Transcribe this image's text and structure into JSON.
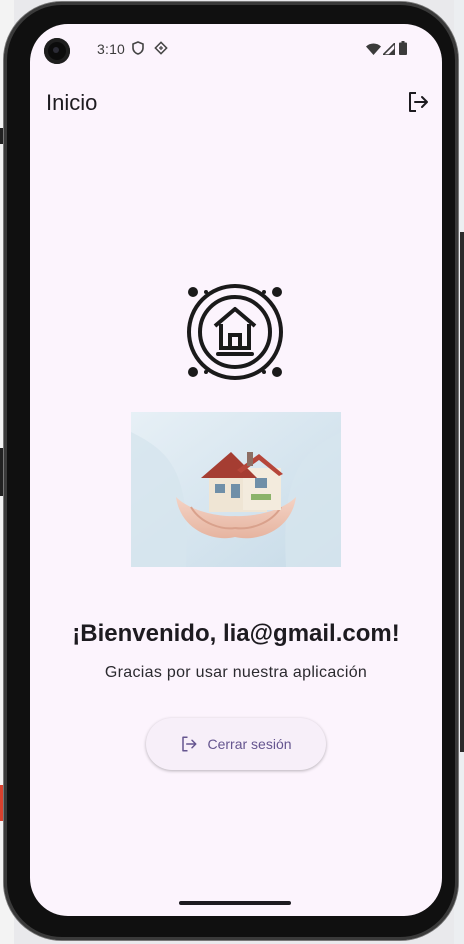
{
  "status_bar": {
    "time": "3:10",
    "left_icons": [
      "shield-icon",
      "location-diamond-icon"
    ],
    "right_icons": [
      "wifi-icon",
      "signal-icon",
      "battery-icon"
    ]
  },
  "app_bar": {
    "title": "Inicio",
    "action_icon": "logout-icon"
  },
  "main": {
    "logo_icon": "house-badge-icon",
    "image_icon": "hands-holding-house-image",
    "welcome_text": "¡Bienvenido, lia@gmail.com!",
    "subtitle": "Gracias por usar nuestra aplicación",
    "logout_button": {
      "label": "Cerrar sesión",
      "icon": "logout-icon"
    }
  },
  "colors": {
    "background": "#fcf4fd",
    "text": "#1d1b20",
    "button_text": "#65558f",
    "button_bg": "#f7eff9"
  }
}
